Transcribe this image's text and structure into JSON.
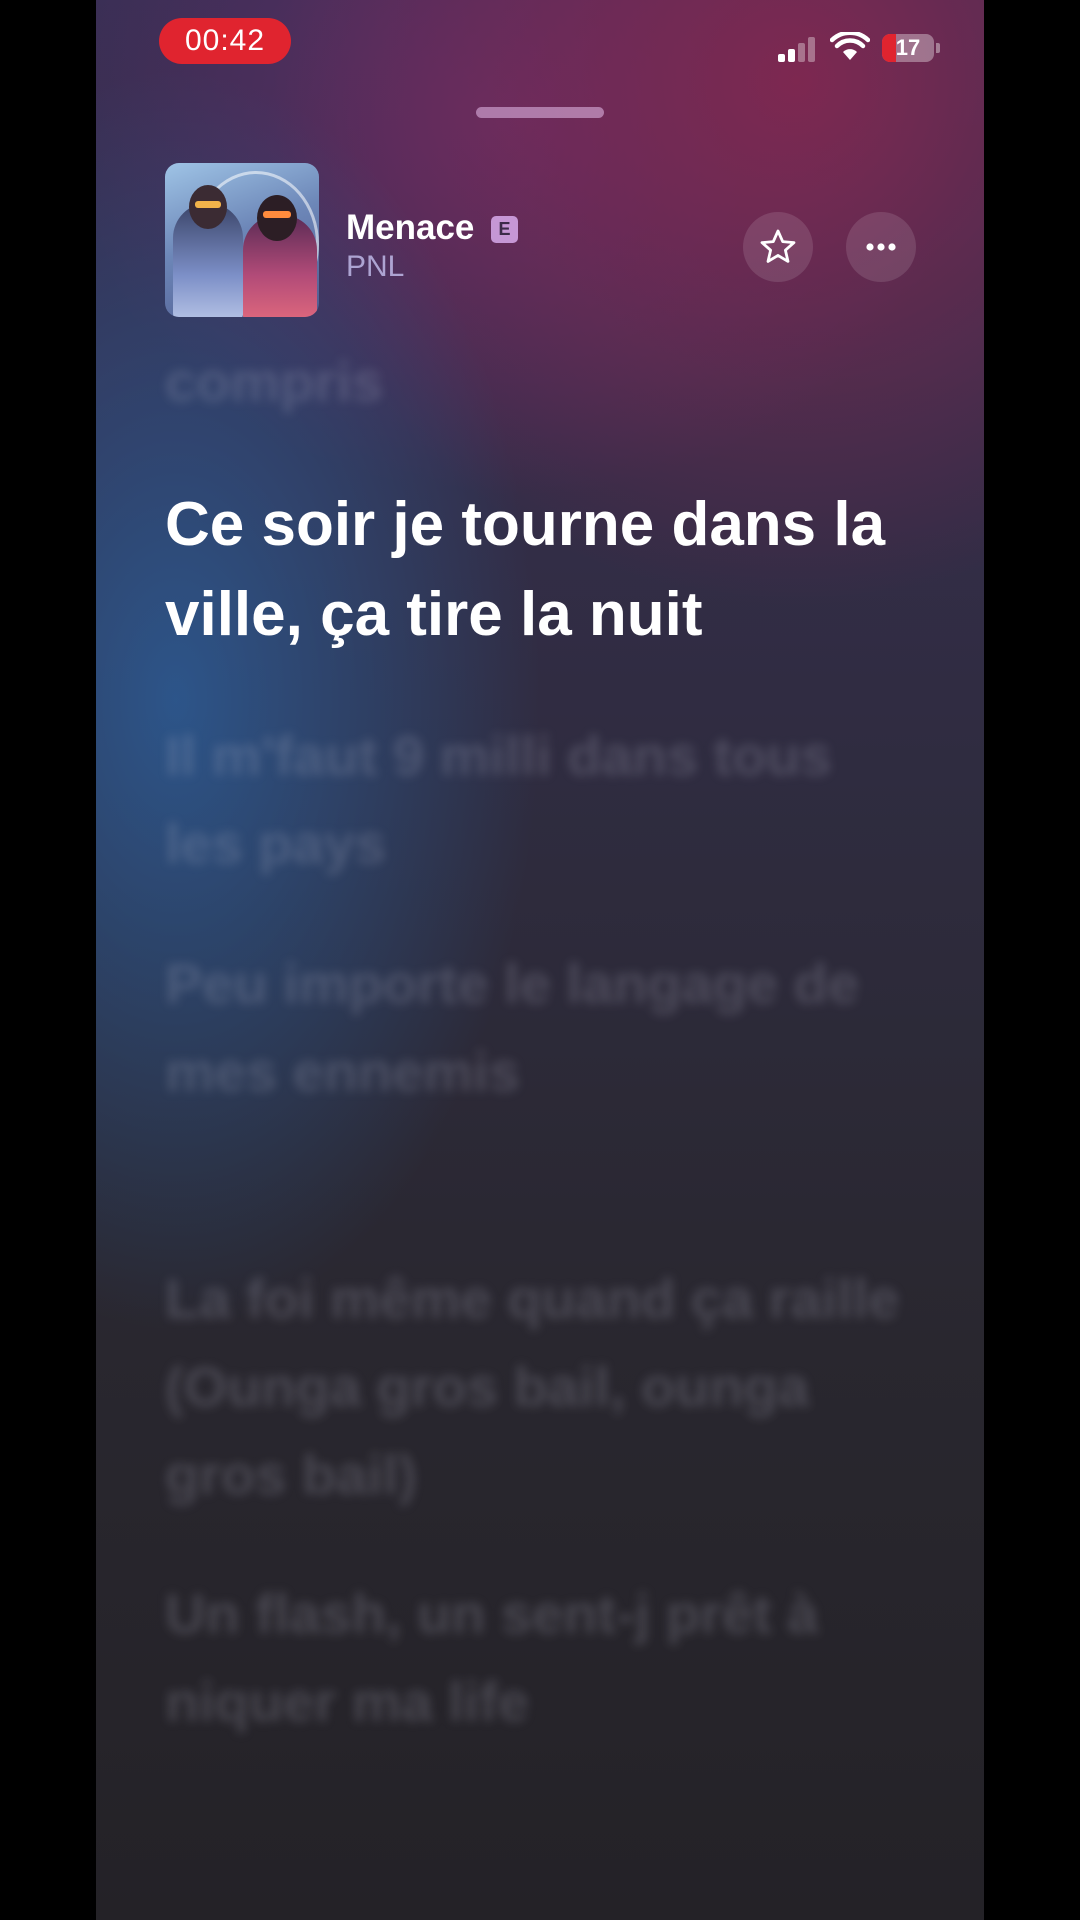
{
  "status_bar": {
    "time": "00:42",
    "battery": "17",
    "colors": {
      "recording": "#e0242f"
    }
  },
  "header": {
    "title": "Menace",
    "explicit_badge": "E",
    "artist": "PNL",
    "favorite_icon": "star-icon",
    "more_icon": "ellipsis-icon"
  },
  "lyrics": {
    "previous": "compris",
    "current": "Ce soir je tourne dans la ville, ça tire la nuit",
    "upcoming": [
      "Il m'faut 9 milli dans tous les pays",
      "Peu importe le langage de mes ennemis",
      "La foi même quand ça raille (Ounga gros bail, ounga gros bail)",
      "Un flash, un sent-j prêt à niquer ma life"
    ]
  }
}
